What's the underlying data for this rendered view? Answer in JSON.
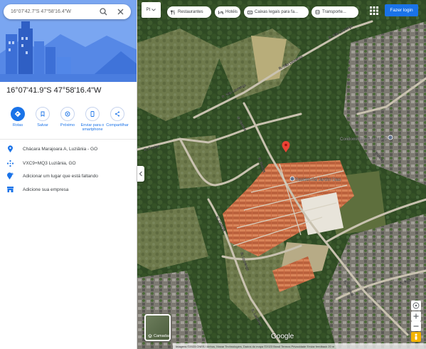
{
  "search": {
    "value": "16°07'42.7\"S 47°58'16.4\"W"
  },
  "coords_title": "16°07'41.9\"S 47°58'16.4\"W",
  "actions": [
    {
      "label": "Rotas",
      "icon": "directions-icon"
    },
    {
      "label": "Salvar",
      "icon": "bookmark-icon"
    },
    {
      "label": "Próximo",
      "icon": "nearby-icon"
    },
    {
      "label": "Enviar para o smartphone",
      "icon": "phone-send-icon"
    },
    {
      "label": "Compartilhar",
      "icon": "share-icon"
    }
  ],
  "info_rows": [
    {
      "text": "Chácara Marajoara A, Luziânia - GO",
      "icon": "pin-icon"
    },
    {
      "text": "VXC9+MQ3 Luziânia, GO",
      "icon": "plus-code-icon"
    },
    {
      "text": "Adicionar um lugar que está faltando",
      "icon": "add-place-icon"
    },
    {
      "text": "Adicione sua empresa",
      "icon": "business-icon"
    }
  ],
  "chips": [
    {
      "label": "Restaurantes",
      "icon": "restaurant-icon"
    },
    {
      "label": "Hotéis",
      "icon": "hotel-icon"
    },
    {
      "label": "Caixas legais para fa...",
      "icon": "atm-icon"
    },
    {
      "label": "Transporte...",
      "icon": "transit-icon"
    }
  ],
  "pt_label": "Pt",
  "signin_label": "Fazer login",
  "layers_label": "Camadas",
  "google_logo": "Google",
  "map_labels": {
    "road1": "R. São Lourenço",
    "road2": "R. São Lourenço",
    "road3": "R. São Lourenço",
    "road4": "R. Dantas",
    "road5": "R. Batista",
    "road6": "R. Dantas",
    "road7": "R. Colônia",
    "road8": "R. Lourenço",
    "road9": "R. Uruguai",
    "road10": "R. Bolivia",
    "road11": "R. Bolivia",
    "road12": "R. Lourenço",
    "poi1": "Condomínio Ipê Amarelo",
    "poi2": "Residencial Jardim Dias"
  },
  "footer": "Imagens ©2023 CNES / Airbus, Maxar Technologies, Dados do mapa ©2023 Brasil   Termos   Privacidade   Enviar feedback   20 m"
}
